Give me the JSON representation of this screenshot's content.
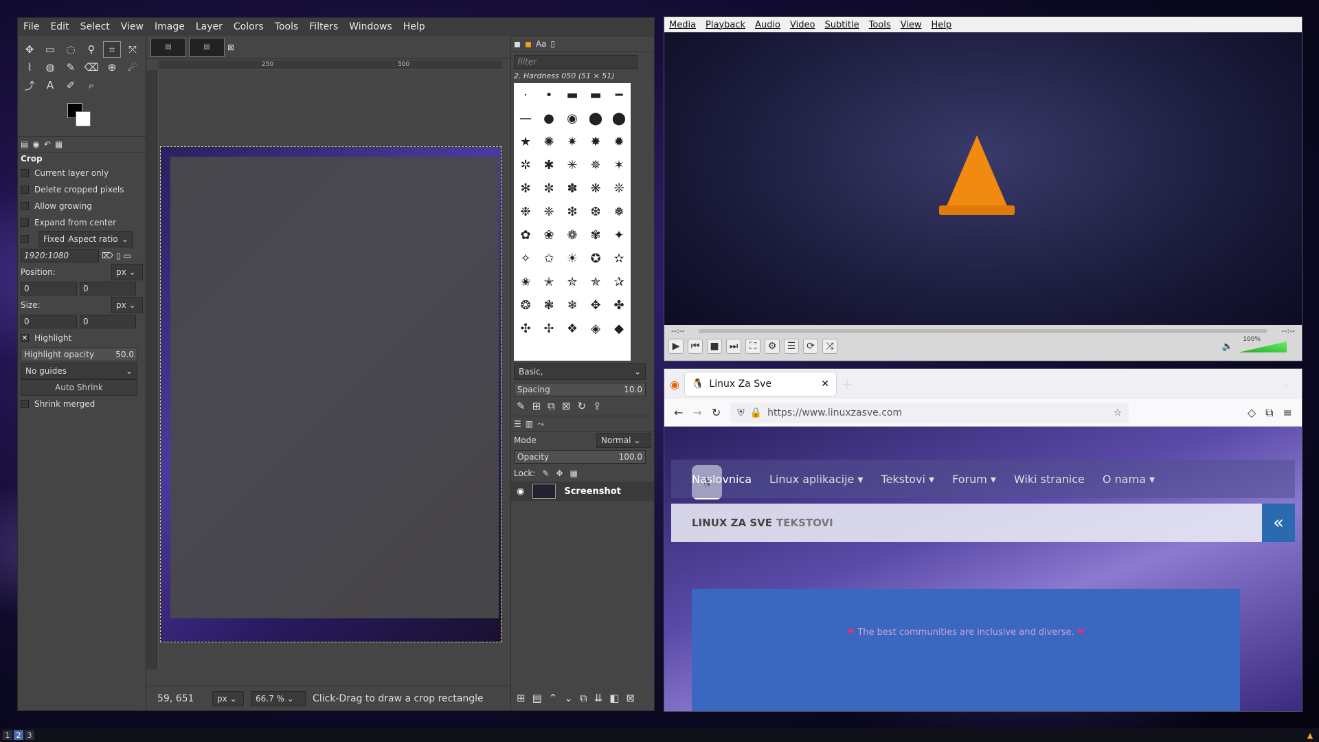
{
  "gimp": {
    "menu": [
      "File",
      "Edit",
      "Select",
      "View",
      "Image",
      "Layer",
      "Colors",
      "Tools",
      "Filters",
      "Windows",
      "Help"
    ],
    "tool_options": {
      "title": "Crop",
      "current_layer_only": "Current layer only",
      "delete_cropped": "Delete cropped pixels",
      "allow_growing": "Allow growing",
      "expand_center": "Expand from center",
      "fixed": "Fixed",
      "aspect_ratio": "Aspect ratio",
      "ratio_value": "1920:1080",
      "position_label": "Position:",
      "position_unit": "px",
      "position_x": "0",
      "position_y": "0",
      "size_label": "Size:",
      "size_unit": "px",
      "size_x": "0",
      "size_y": "0",
      "highlight": "Highlight",
      "highlight_opacity_label": "Highlight opacity",
      "highlight_opacity_value": "50.0",
      "guides": "No guides",
      "auto_shrink": "Auto Shrink",
      "shrink_merged": "Shrink merged"
    },
    "ruler": {
      "t250": "250",
      "t500": "500"
    },
    "status": {
      "coords": "59, 651",
      "unit": "px",
      "zoom": "66.7 %",
      "message": "Click-Drag to draw a crop rectangle"
    },
    "brushes": {
      "filter_placeholder": "filter",
      "current": "2. Hardness 050 (51 × 51)",
      "tag": "Basic,",
      "spacing_label": "Spacing",
      "spacing_value": "10.0"
    },
    "layers": {
      "mode_label": "Mode",
      "mode_value": "Normal",
      "opacity_label": "Opacity",
      "opacity_value": "100.0",
      "lock_label": "Lock:",
      "layer_name": "Screenshot"
    }
  },
  "vlc": {
    "menu": [
      "Media",
      "Playback",
      "Audio",
      "Video",
      "Subtitle",
      "Tools",
      "View",
      "Help"
    ],
    "time_left": "--:--",
    "time_right": "--:--",
    "volume": "100%"
  },
  "firefox": {
    "tab_title": "Linux Za Sve",
    "url": "https://www.linuxzasve.com",
    "nav": [
      "Naslovnica",
      "Linux aplikacije ▾",
      "Tekstovi ▾",
      "Forum ▾",
      "Wiki stranice",
      "O nama ▾"
    ],
    "heading_main": "LINUX ZA SVE",
    "heading_sub": "TEKSTOVI",
    "banner_text": "The best communities are inclusive and diverse."
  },
  "taskbar": {
    "ws1": "1",
    "ws2": "2",
    "ws3": "3"
  }
}
